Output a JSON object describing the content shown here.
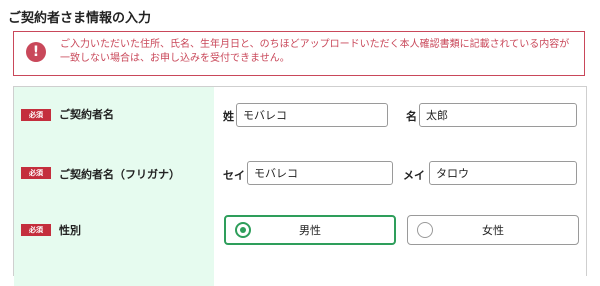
{
  "page": {
    "title": "ご契約者さま情報の入力"
  },
  "alert": {
    "icon": "exclamation-icon",
    "message": "ご入力いただいた住所、氏名、生年月日と、のちほどアップロードいただく本人確認書類に記載されている内容が一致しない場合は、お申し込みを受付できません。"
  },
  "form": {
    "required_badge": "必須",
    "rows": [
      {
        "label": "ご契約者名",
        "fields": [
          {
            "label": "姓",
            "value": "モバレコ"
          },
          {
            "label": "名",
            "value": "太郎"
          }
        ]
      },
      {
        "label": "ご契約者名（フリガナ）",
        "fields": [
          {
            "label": "セイ",
            "value": "モバレコ"
          },
          {
            "label": "メイ",
            "value": "タロウ"
          }
        ]
      },
      {
        "label": "性別",
        "options": [
          {
            "label": "男性",
            "selected": true
          },
          {
            "label": "女性",
            "selected": false
          }
        ]
      }
    ]
  },
  "colors": {
    "accent_green": "#2e9e5b",
    "label_bg": "#e6fbef",
    "alert_red": "#c9485a",
    "required_red": "#c42e3d"
  }
}
